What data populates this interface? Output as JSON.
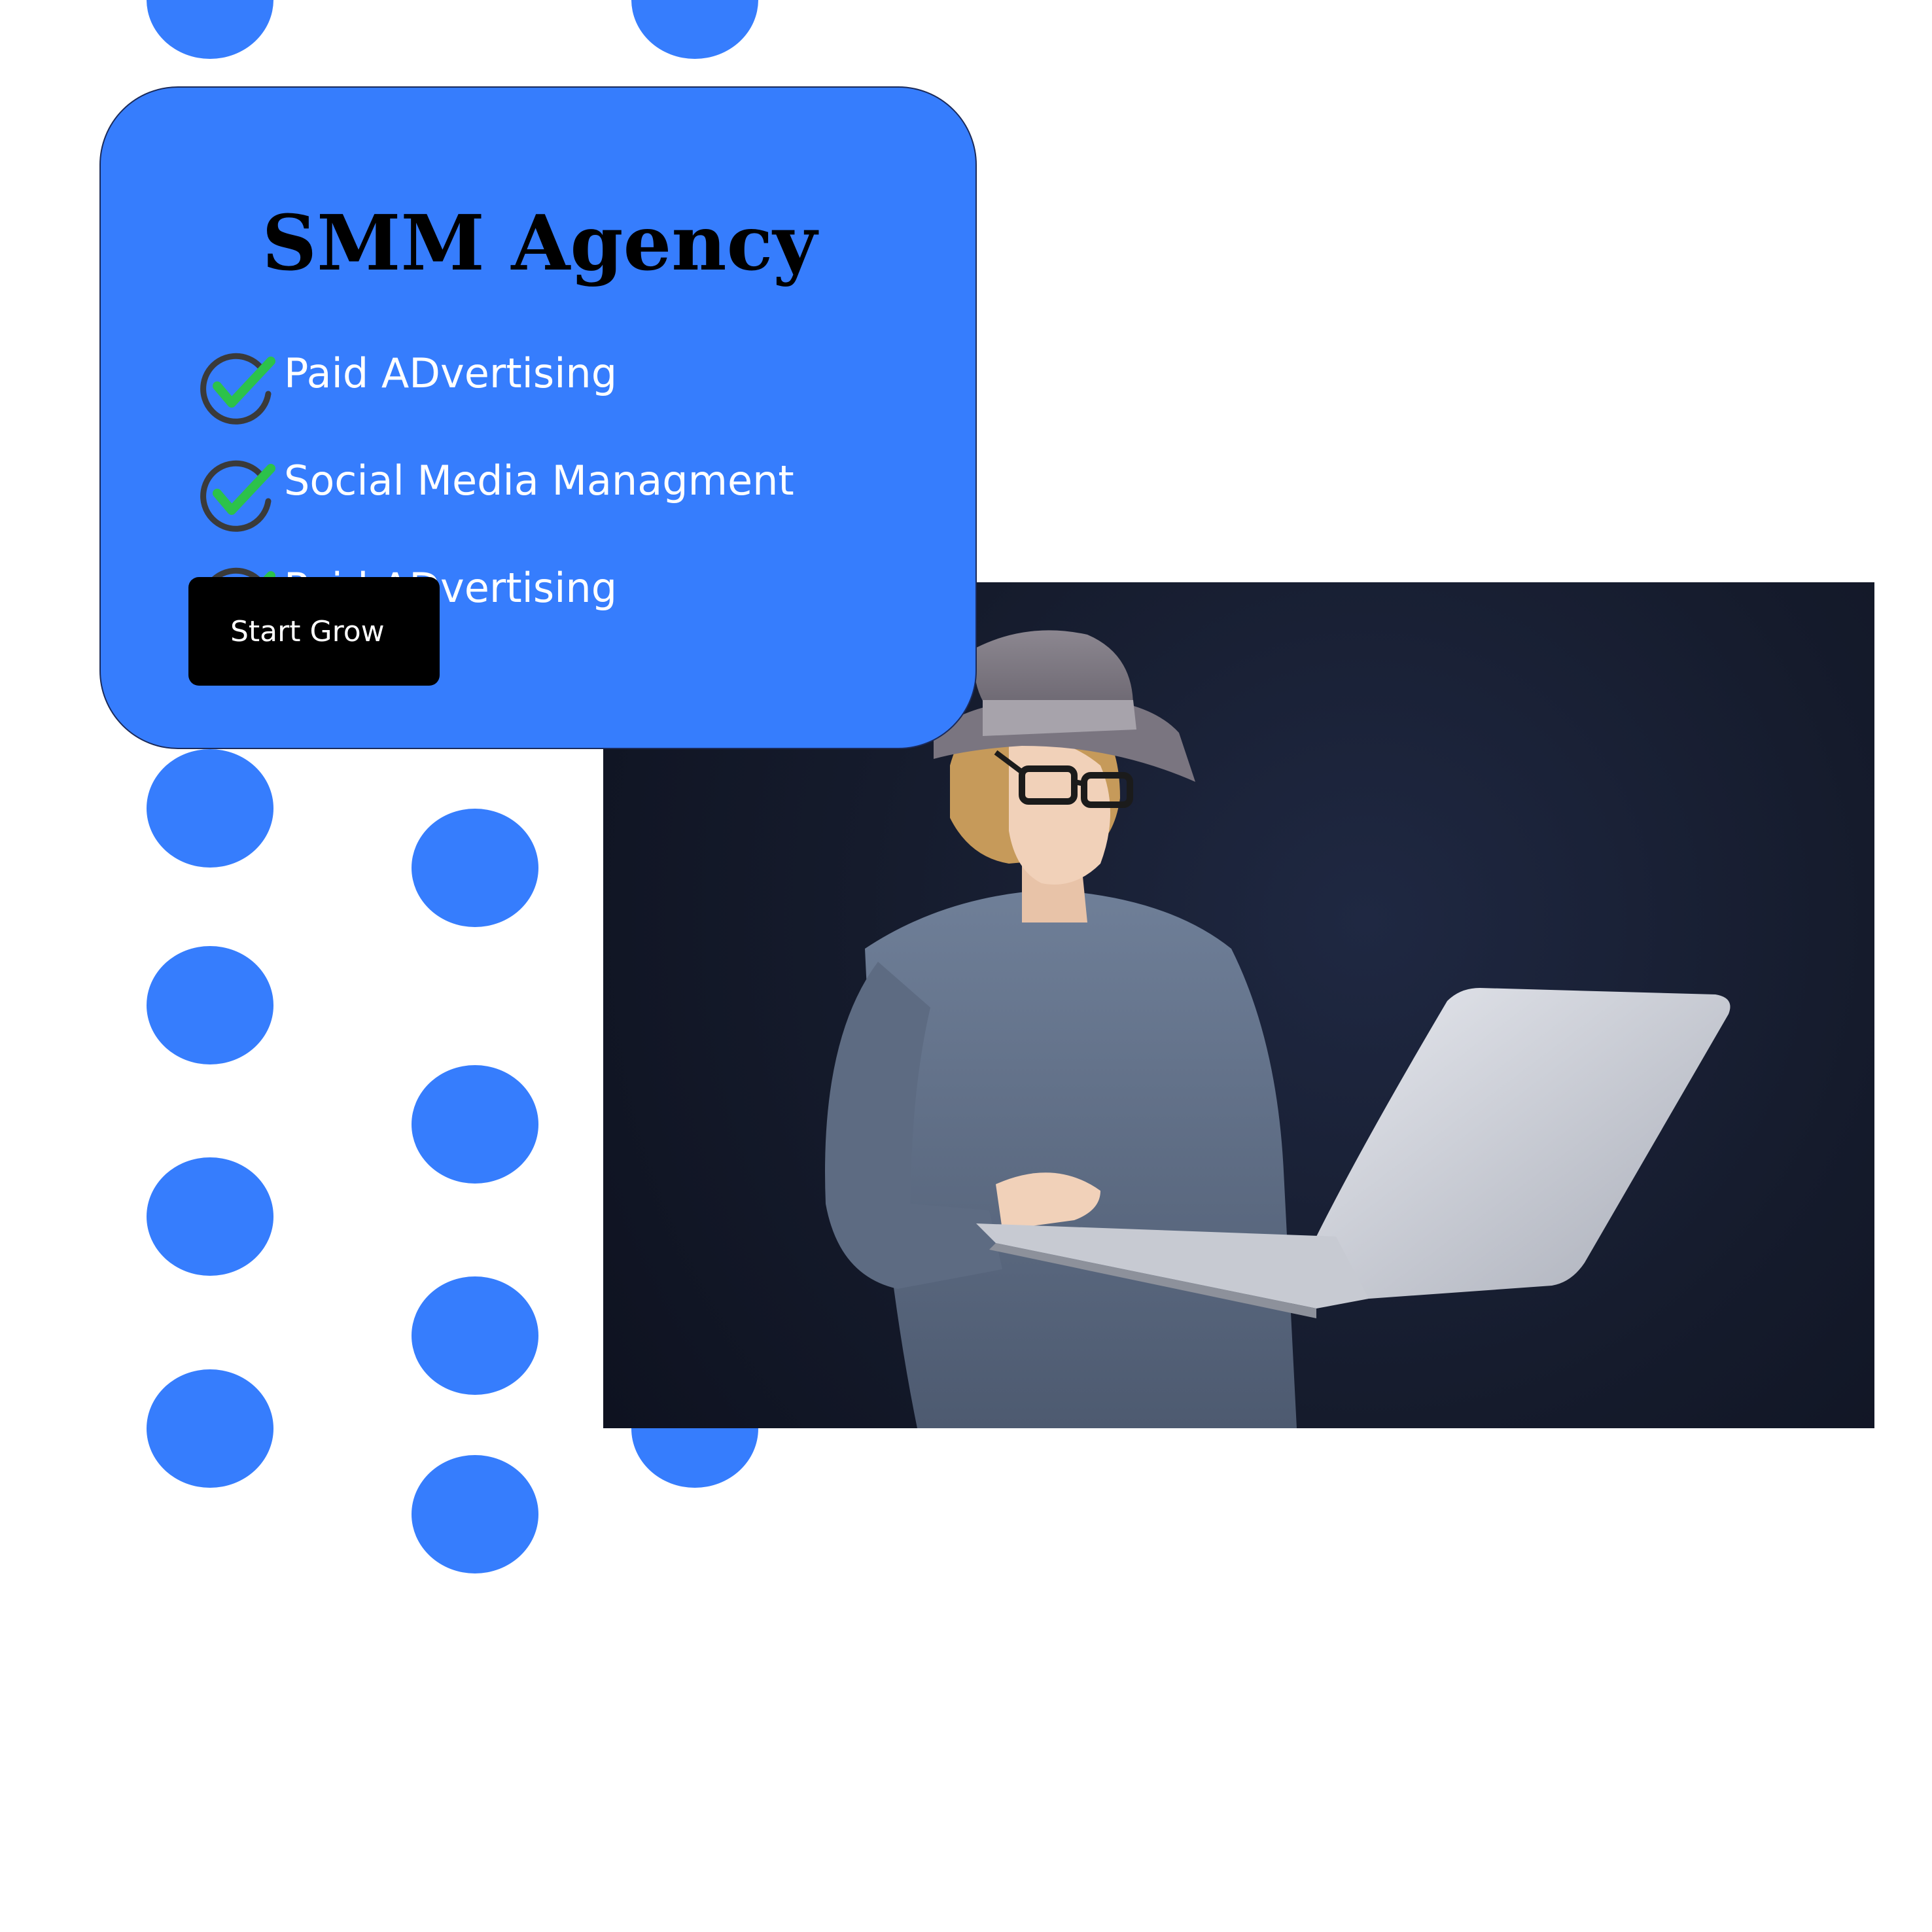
{
  "card": {
    "title": "SMM Agency",
    "features": [
      {
        "label": "Paid ADvertising",
        "icon": "check-circle-icon"
      },
      {
        "label": "Social Media Managment",
        "icon": "check-circle-icon"
      },
      {
        "label": "Paid ADvertising",
        "icon": "check-circle-icon"
      }
    ],
    "cta_label": "Start Grow"
  },
  "hero_image": {
    "subject": "person-with-laptop-photo"
  },
  "colors": {
    "accent": "#367dfd",
    "check": "#2cc24a",
    "ring": "#3a3a3a",
    "cta_bg": "#000000",
    "photo_bg": "#151b2c"
  }
}
